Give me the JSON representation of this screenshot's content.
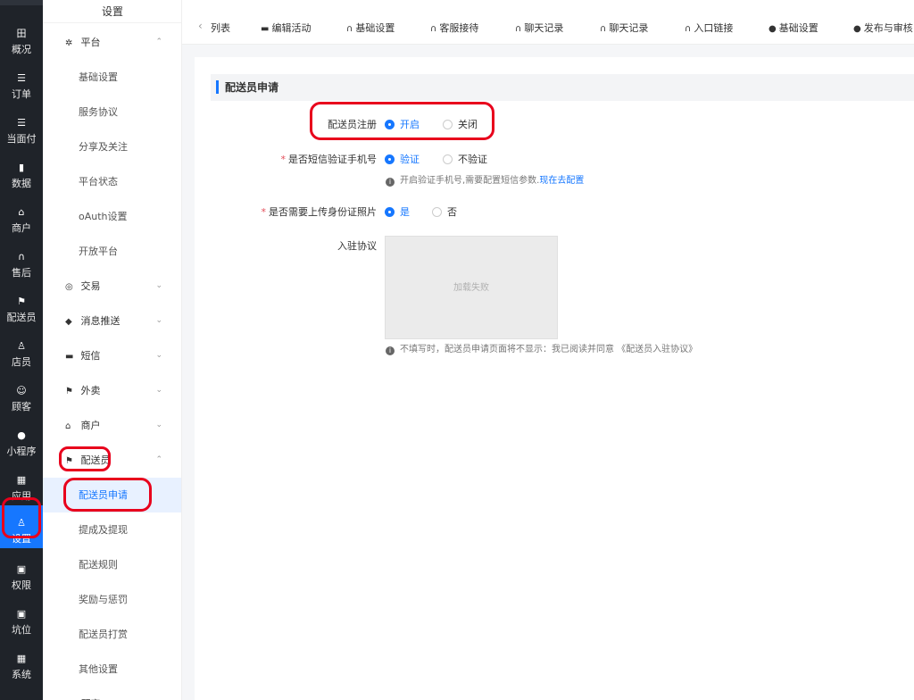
{
  "rail": {
    "items": [
      {
        "icon": "田",
        "label": "概况"
      },
      {
        "icon": "☰",
        "label": "订单"
      },
      {
        "icon": "☰",
        "label": "当面付"
      },
      {
        "icon": "▮",
        "label": "数据"
      },
      {
        "icon": "⌂",
        "label": "商户"
      },
      {
        "icon": "∩",
        "label": "售后"
      },
      {
        "icon": "⚑",
        "label": "配送员"
      },
      {
        "icon": "♙",
        "label": "店员"
      },
      {
        "icon": "☺",
        "label": "顾客"
      },
      {
        "icon": "●",
        "label": "小程序"
      },
      {
        "icon": "▦",
        "label": "应用"
      },
      {
        "icon": "♙",
        "label": "设置"
      },
      {
        "icon": "▣",
        "label": "权限"
      },
      {
        "icon": "▣",
        "label": "坑位"
      },
      {
        "icon": "▦",
        "label": "系统"
      }
    ]
  },
  "sidebar": {
    "title": "设置",
    "rows": [
      {
        "type": "group",
        "icon": "✲",
        "label": "平台",
        "chev": "⌃"
      },
      {
        "type": "sub",
        "label": "基础设置"
      },
      {
        "type": "sub",
        "label": "服务协议"
      },
      {
        "type": "sub",
        "label": "分享及关注"
      },
      {
        "type": "sub",
        "label": "平台状态"
      },
      {
        "type": "sub",
        "label": "oAuth设置"
      },
      {
        "type": "sub",
        "label": "开放平台"
      },
      {
        "type": "group",
        "icon": "◎",
        "label": "交易",
        "chev": "⌄"
      },
      {
        "type": "group",
        "icon": "◆",
        "label": "消息推送",
        "chev": "⌄"
      },
      {
        "type": "group",
        "icon": "▬",
        "label": "短信",
        "chev": "⌄"
      },
      {
        "type": "group",
        "icon": "⚑",
        "label": "外卖",
        "chev": "⌄"
      },
      {
        "type": "group",
        "icon": "⌂",
        "label": "商户",
        "chev": "⌄"
      },
      {
        "type": "group",
        "icon": "⚑",
        "label": "配送员",
        "chev": "⌃"
      },
      {
        "type": "sub",
        "label": "配送员申请",
        "active": true
      },
      {
        "type": "sub",
        "label": "提成及提现"
      },
      {
        "type": "sub",
        "label": "配送规则"
      },
      {
        "type": "sub",
        "label": "奖励与惩罚"
      },
      {
        "type": "sub",
        "label": "配送员打赏"
      },
      {
        "type": "sub",
        "label": "其他设置"
      },
      {
        "type": "group",
        "icon": "☺",
        "label": "顾客",
        "chev": "⌄"
      }
    ]
  },
  "tabs": {
    "back": "‹",
    "items": [
      {
        "icon": "",
        "label": "列表"
      },
      {
        "icon": "▬",
        "label": "编辑活动"
      },
      {
        "icon": "∩",
        "label": "基础设置"
      },
      {
        "icon": "∩",
        "label": "客服接待"
      },
      {
        "icon": "∩",
        "label": "聊天记录"
      },
      {
        "icon": "∩",
        "label": "聊天记录"
      },
      {
        "icon": "∩",
        "label": "入口链接"
      },
      {
        "icon": "●",
        "label": "基础设置"
      },
      {
        "icon": "●",
        "label": "发布与审核"
      }
    ]
  },
  "main": {
    "section_title": "配送员申请",
    "register": {
      "label": "配送员注册",
      "option_on": "开启",
      "option_off": "关闭"
    },
    "sms": {
      "required": "*",
      "label": "是否短信验证手机号",
      "option_yes": "验证",
      "option_no": "不验证",
      "hint": "开启验证手机号,需要配置短信参数.",
      "hint_link": "现在去配置"
    },
    "idcard": {
      "required": "*",
      "label": "是否需要上传身份证照片",
      "option_yes": "是",
      "option_no": "否"
    },
    "agreement": {
      "label": "入驻协议",
      "image_fail": "加载失败",
      "hint": "不填写时，配送员申请页面将不显示：我已阅读并同意 《配送员入驻协议》"
    }
  },
  "colors": {
    "rail_bg": "#1f2329",
    "accent": "#1677ff",
    "highlight": "#e8001c"
  }
}
